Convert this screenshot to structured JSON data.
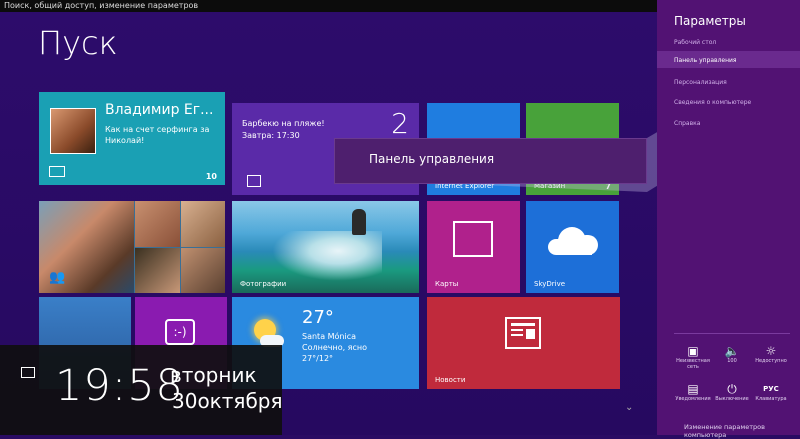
{
  "window": {
    "title": "Поиск, общий доступ, изменение параметров"
  },
  "start": {
    "title": "Пуск",
    "tiles": {
      "people": {
        "name": "Владимир Ег...",
        "message": "Как на счет серфинга за Николай!",
        "badge": "10"
      },
      "calendar": {
        "event": "Барбекю на пляже!",
        "time": "Завтра: 17:30",
        "day": "2"
      },
      "ie": {
        "label": "Internet Explorer"
      },
      "store": {
        "label": "Магазин",
        "badge": "7"
      },
      "photos": {
        "label": "Фотографии"
      },
      "maps": {
        "label": "Карты"
      },
      "skydrive": {
        "label": "SkyDrive"
      },
      "weather": {
        "temp": "27°",
        "city": "Santa Mónica",
        "cond": "Солнечно, ясно",
        "range": "27°/12°"
      },
      "news": {
        "label": "Новости"
      }
    }
  },
  "lock": {
    "time": "19:58",
    "weekday": "вторник",
    "date": "30октября"
  },
  "charms": {
    "title": "Параметры",
    "items": [
      {
        "label": "Рабочий стол"
      },
      {
        "label": "Панель управления"
      },
      {
        "label": "Персонализация"
      },
      {
        "label": "Сведения о компьютере"
      },
      {
        "label": "Справка"
      }
    ],
    "system": [
      {
        "label": "Неизвестная сеть",
        "icon": "network-icon"
      },
      {
        "label": "100",
        "icon": "volume-icon"
      },
      {
        "label": "Недоступно",
        "icon": "brightness-icon"
      },
      {
        "label": "Уведомления",
        "icon": "notifications-icon"
      },
      {
        "label": "Выключение",
        "icon": "power-icon"
      },
      {
        "label": "Клавиатура",
        "icon": "keyboard-icon",
        "glyph": "РУС"
      }
    ],
    "pc_settings": "Изменение параметров компьютера"
  },
  "tooltip": {
    "text": "Панель управления"
  },
  "colors": {
    "start_bg": "#2a0b63",
    "charms_bg": "#521273",
    "people": "#1aa0b4",
    "ie": "#1f7de0",
    "store": "#48a23a",
    "maps": "#b0218c",
    "skydrive": "#1d6fd8",
    "news": "#c02a3c"
  }
}
